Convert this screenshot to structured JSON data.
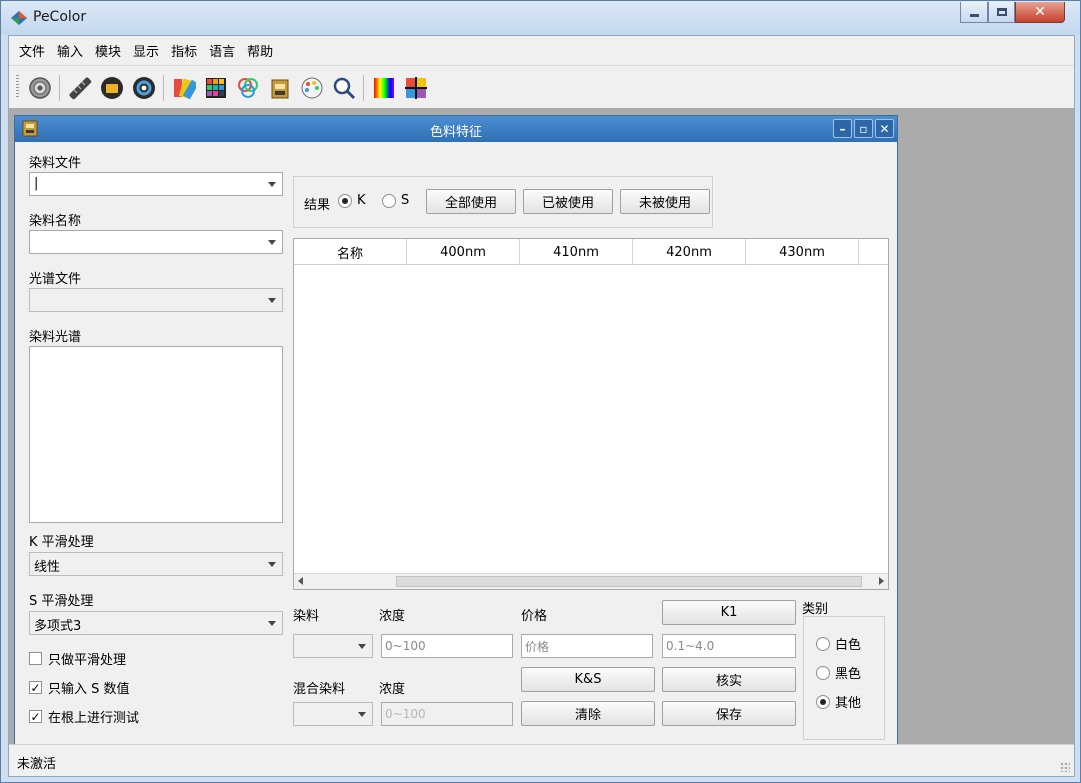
{
  "window": {
    "title": "PeColor"
  },
  "menu": [
    "文件",
    "输入",
    "模块",
    "显示",
    "指标",
    "语言",
    "帮助"
  ],
  "toolbar": {
    "icons": [
      "settings-icon",
      "ruler-icon",
      "folder-icon",
      "color-ring-icon",
      "palette-fan-icon",
      "color-grid-icon",
      "rgb-circles-icon",
      "dye-bottle-icon",
      "color-wheel-icon",
      "magnifier-icon",
      "spectrum-icon",
      "cross-color-icon"
    ]
  },
  "child": {
    "title": "色料特征",
    "dye_file_label": "染料文件",
    "dye_file_value": "|",
    "dye_name_label": "染料名称",
    "spectrum_file_label": "光谱文件",
    "dye_spectrum_label": "染料光谱",
    "k_smooth_label": "K 平滑处理",
    "k_smooth_value": "线性",
    "s_smooth_label": "S 平滑处理",
    "s_smooth_value": "多项式3",
    "chk_only_smooth": "只做平滑处理",
    "chk_only_s": "只输入 S 数值",
    "chk_root_test": "在根上进行测试",
    "result_label": "结果",
    "radio_k": "K",
    "radio_s": "S",
    "btn_all": "全部使用",
    "btn_used": "已被使用",
    "btn_unused": "未被使用",
    "columns": [
      "名称",
      "400nm",
      "410nm",
      "420nm",
      "430nm"
    ],
    "dye_label": "染料",
    "conc_label": "浓度",
    "price_label": "价格",
    "conc_placeholder": "0~100",
    "price_placeholder": "价格",
    "k1_placeholder": "0.1~4.0",
    "btn_k1": "K1",
    "mix_dye_label": "混合染料",
    "conc2_label": "浓度",
    "conc2_placeholder": "0~100",
    "btn_ks": "K&S",
    "btn_verify": "核实",
    "btn_clear": "清除",
    "btn_save": "保存",
    "category_label": "类别",
    "cat_white": "白色",
    "cat_black": "黑色",
    "cat_other": "其他"
  },
  "status": {
    "text": "未激活"
  }
}
